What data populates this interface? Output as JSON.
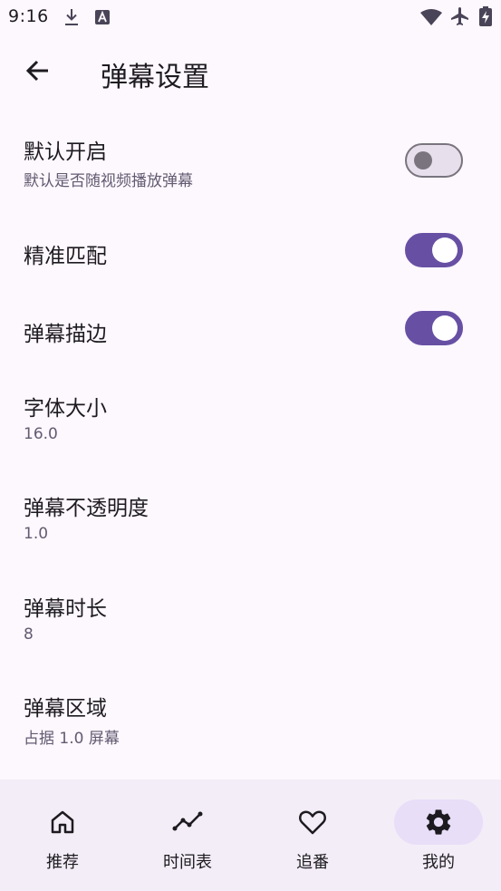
{
  "status_bar": {
    "time": "9:16"
  },
  "app_bar": {
    "title": "弹幕设置"
  },
  "settings": [
    {
      "title": "默认开启",
      "subtitle": "默认是否随视频播放弹幕",
      "toggle": false
    },
    {
      "title": "精准匹配",
      "toggle": true
    },
    {
      "title": "弹幕描边",
      "toggle": true
    },
    {
      "title": "字体大小",
      "subtitle": "16.0"
    },
    {
      "title": "弹幕不透明度",
      "subtitle": "1.0"
    },
    {
      "title": "弹幕时长",
      "subtitle": "8"
    },
    {
      "title": "弹幕区域",
      "subtitle": "占据 1.0 屏幕"
    }
  ],
  "bottom_nav": {
    "items": [
      {
        "label": "推荐",
        "icon": "home-icon"
      },
      {
        "label": "时间表",
        "icon": "timeline-icon"
      },
      {
        "label": "追番",
        "icon": "heart-icon"
      },
      {
        "label": "我的",
        "icon": "gear-icon",
        "selected": true
      }
    ]
  },
  "colors": {
    "background": "#fdf7fe",
    "accent": "#6750a4",
    "nav_background": "#f3edf7",
    "nav_indicator": "#e8def8"
  }
}
